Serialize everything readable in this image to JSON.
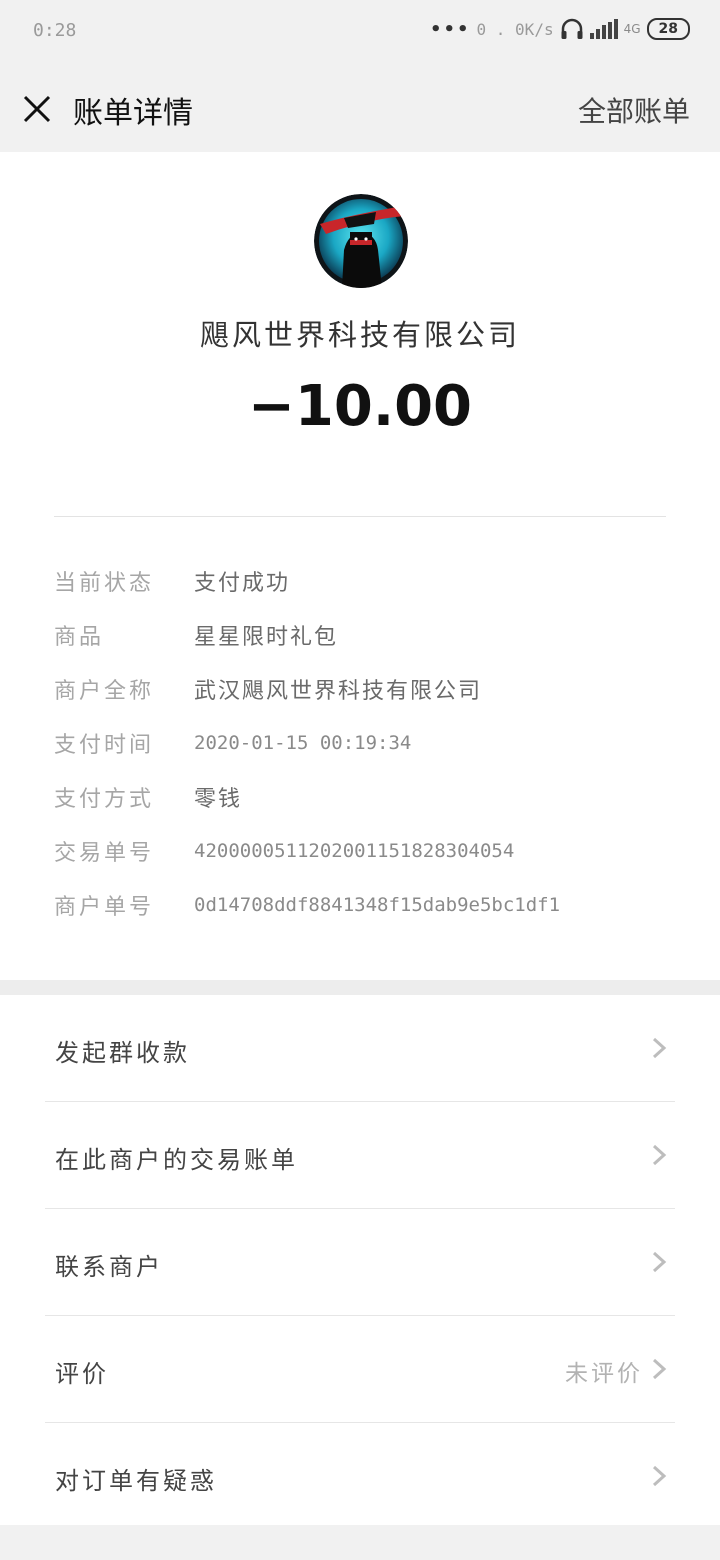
{
  "status_bar": {
    "time": "0:28",
    "dots": "•••",
    "network_speed": "0 . 0K/s",
    "network_type": "4G",
    "battery": "28"
  },
  "header": {
    "title": "账单详情",
    "all_bills": "全部账单"
  },
  "merchant": {
    "name": "飓风世界科技有限公司",
    "amount": "−10.00"
  },
  "details": [
    {
      "label": "当前状态",
      "value": "支付成功"
    },
    {
      "label": "商品",
      "value": "星星限时礼包"
    },
    {
      "label": "商户全称",
      "value": "武汉飓风世界科技有限公司"
    },
    {
      "label": "支付时间",
      "value": "2020-01-15 00:19:34"
    },
    {
      "label": "支付方式",
      "value": "零钱"
    },
    {
      "label": "交易单号",
      "value": "4200000511202001151828304054"
    },
    {
      "label": "商户单号",
      "value": "0d14708ddf8841348f15dab9e5bc1df1"
    }
  ],
  "actions": [
    {
      "label": "发起群收款",
      "value": ""
    },
    {
      "label": "在此商户的交易账单",
      "value": ""
    },
    {
      "label": "联系商户",
      "value": ""
    },
    {
      "label": "评价",
      "value": "未评价"
    },
    {
      "label": "对订单有疑惑",
      "value": ""
    }
  ],
  "colors": {
    "background": "#ededed",
    "card": "#ffffff",
    "amount_text": "#111111",
    "label_gray": "#a6a6a6"
  },
  "icons": [
    "close-icon",
    "headset-icon",
    "signal-icon",
    "chevron-right-icon"
  ]
}
